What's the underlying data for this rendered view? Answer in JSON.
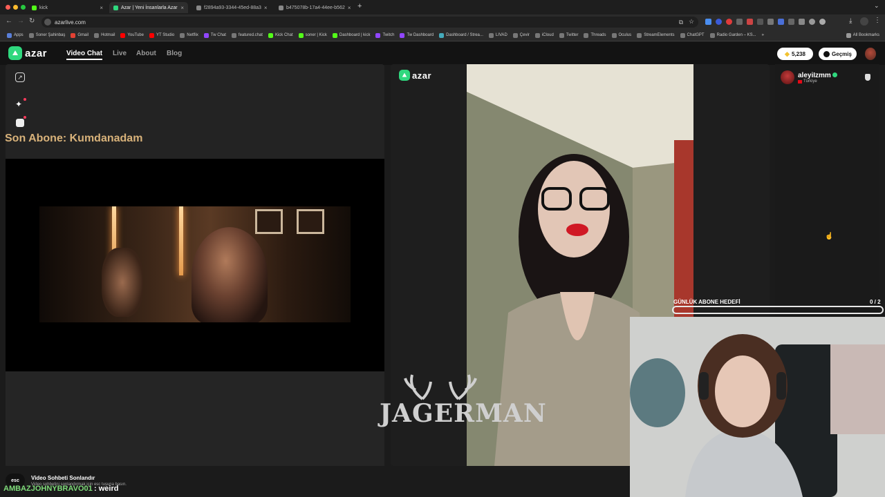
{
  "browser": {
    "tabs": [
      {
        "title": "kick",
        "active": false,
        "fav_color": "#53fc18"
      },
      {
        "title": "Azar | Yeni İnsanlarla Azar",
        "active": true,
        "fav_color": "#2fd87e"
      },
      {
        "title": "f2894a93-3344-45ed-88a3",
        "active": false,
        "fav_color": "#888888"
      },
      {
        "title": "b475078b-17a4-44ee-b562",
        "active": false,
        "fav_color": "#888888"
      }
    ],
    "url": "azarlive.com",
    "bookmarks": [
      "Apps",
      "Soner Şahinbaş",
      "Gmail",
      "Hotmail",
      "YouTube",
      "YT Studio",
      "Netflix",
      "Tw Chat",
      "featured.chat",
      "Kick Chat",
      "soner | Kick",
      "Dashboard | kick",
      "Twitch",
      "Tw Dashboard",
      "Dashboard / Strea...",
      "LIVAD",
      "Çevir",
      "iCloud",
      "Twitter",
      "Threads",
      "Oculus",
      "StreamElements",
      "ChatGPT",
      "Radio Garden – KS...",
      "»",
      "All Bookmarks"
    ]
  },
  "app": {
    "logo": "azar",
    "nav": [
      "Video Chat",
      "Live",
      "About",
      "Blog"
    ],
    "gems": "5,238",
    "history_label": "Geçmiş"
  },
  "overlay": {
    "last_sub": "Son Abone: Kumdanadam",
    "daily_goal_label": "GÜNLÜK ABONE HEDEFİ",
    "daily_goal_count": "0 / 2",
    "daily_goal_progress": 0,
    "watermark": "JAGERMAN"
  },
  "partner": {
    "name": "aleyiIzmm",
    "country": "Türkiye"
  },
  "bottom": {
    "esc": "esc",
    "ended_title": "Video Sohbeti Sonlandır",
    "ended_hint": "Video sohbetini sonlandırmak için esc tuşuna basın.",
    "chat_user": "AMBAZJOHNYBRAVO01",
    "chat_msg": ": weird"
  },
  "colors": {
    "brand": "#2fd87e",
    "sub_text": "#d8b27a",
    "chat_user": "#7fdc7a"
  }
}
